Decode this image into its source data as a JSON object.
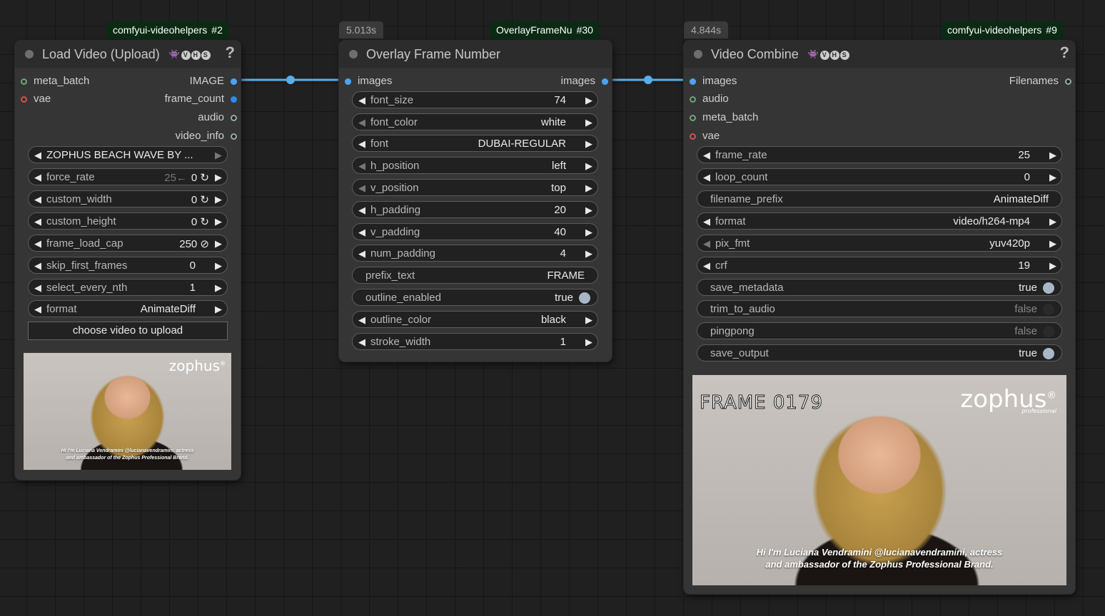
{
  "nodes": {
    "load_video": {
      "badge_pack": "comfyui-videohelpers",
      "badge_id": "#2",
      "title": "Load Video (Upload)",
      "vhs_mark": "VHS",
      "help": "?",
      "inputs": [
        "meta_batch",
        "vae"
      ],
      "outputs": [
        "IMAGE",
        "frame_count",
        "audio",
        "video_info"
      ],
      "video_select": "ZOPHUS BEACH WAVE BY ...",
      "widgets": [
        {
          "label": "force_rate",
          "extra": "25←",
          "value": "0 ↻"
        },
        {
          "label": "custom_width",
          "value": "0 ↻"
        },
        {
          "label": "custom_height",
          "value": "0 ↻"
        },
        {
          "label": "frame_load_cap",
          "value": "250 ⊘"
        },
        {
          "label": "skip_first_frames",
          "value": "0"
        },
        {
          "label": "select_every_nth",
          "value": "1"
        },
        {
          "label": "format",
          "value": "AnimateDiff"
        }
      ],
      "upload_button": "choose video to upload",
      "preview": {
        "brand": "zophus",
        "caption_line1": "Hi I'm Luciana Vendramini @lucianavendramini, actress",
        "caption_line2": "and ambassador of the Zophus Professional Brand."
      }
    },
    "overlay": {
      "timer": "5.013s",
      "badge_pack": "OverlayFrameNu",
      "badge_id": "#30",
      "title": "Overlay Frame Number",
      "input": "images",
      "output": "images",
      "widgets": [
        {
          "label": "font_size",
          "value": "74"
        },
        {
          "label": "font_color",
          "value": "white"
        },
        {
          "label": "font",
          "value": "DUBAI-REGULAR"
        },
        {
          "label": "h_position",
          "value": "left"
        },
        {
          "label": "v_position",
          "value": "top"
        },
        {
          "label": "h_padding",
          "value": "20"
        },
        {
          "label": "v_padding",
          "value": "40"
        },
        {
          "label": "num_padding",
          "value": "4"
        },
        {
          "label": "prefix_text",
          "value": "FRAME"
        },
        {
          "label": "outline_enabled",
          "value": "true"
        },
        {
          "label": "outline_color",
          "value": "black"
        },
        {
          "label": "stroke_width",
          "value": "1"
        }
      ]
    },
    "video_combine": {
      "timer": "4.844s",
      "badge_pack": "comfyui-videohelpers",
      "badge_id": "#9",
      "title": "Video Combine",
      "vhs_mark": "VHS",
      "help": "?",
      "inputs": [
        "images",
        "audio",
        "meta_batch",
        "vae"
      ],
      "output": "Filenames",
      "widgets": [
        {
          "label": "frame_rate",
          "value": "25"
        },
        {
          "label": "loop_count",
          "value": "0"
        },
        {
          "label": "filename_prefix",
          "value": "AnimateDiff"
        },
        {
          "label": "format",
          "value": "video/h264-mp4"
        },
        {
          "label": "pix_fmt",
          "value": "yuv420p"
        },
        {
          "label": "crf",
          "value": "19"
        },
        {
          "label": "save_metadata",
          "value": "true"
        },
        {
          "label": "trim_to_audio",
          "value": "false"
        },
        {
          "label": "pingpong",
          "value": "false"
        },
        {
          "label": "save_output",
          "value": "true"
        }
      ],
      "preview": {
        "frame_text": "FRAME 0179",
        "brand": "zophus",
        "brand_sub": "professional",
        "caption_line1": "Hi I'm Luciana Vendramini @lucianavendramini, actress",
        "caption_line2": "and ambassador of the Zophus Professional Brand."
      }
    }
  },
  "colors": {
    "wire": "#5aaee8",
    "badge_bg": "#0a2a14",
    "node_bg": "#353535"
  }
}
